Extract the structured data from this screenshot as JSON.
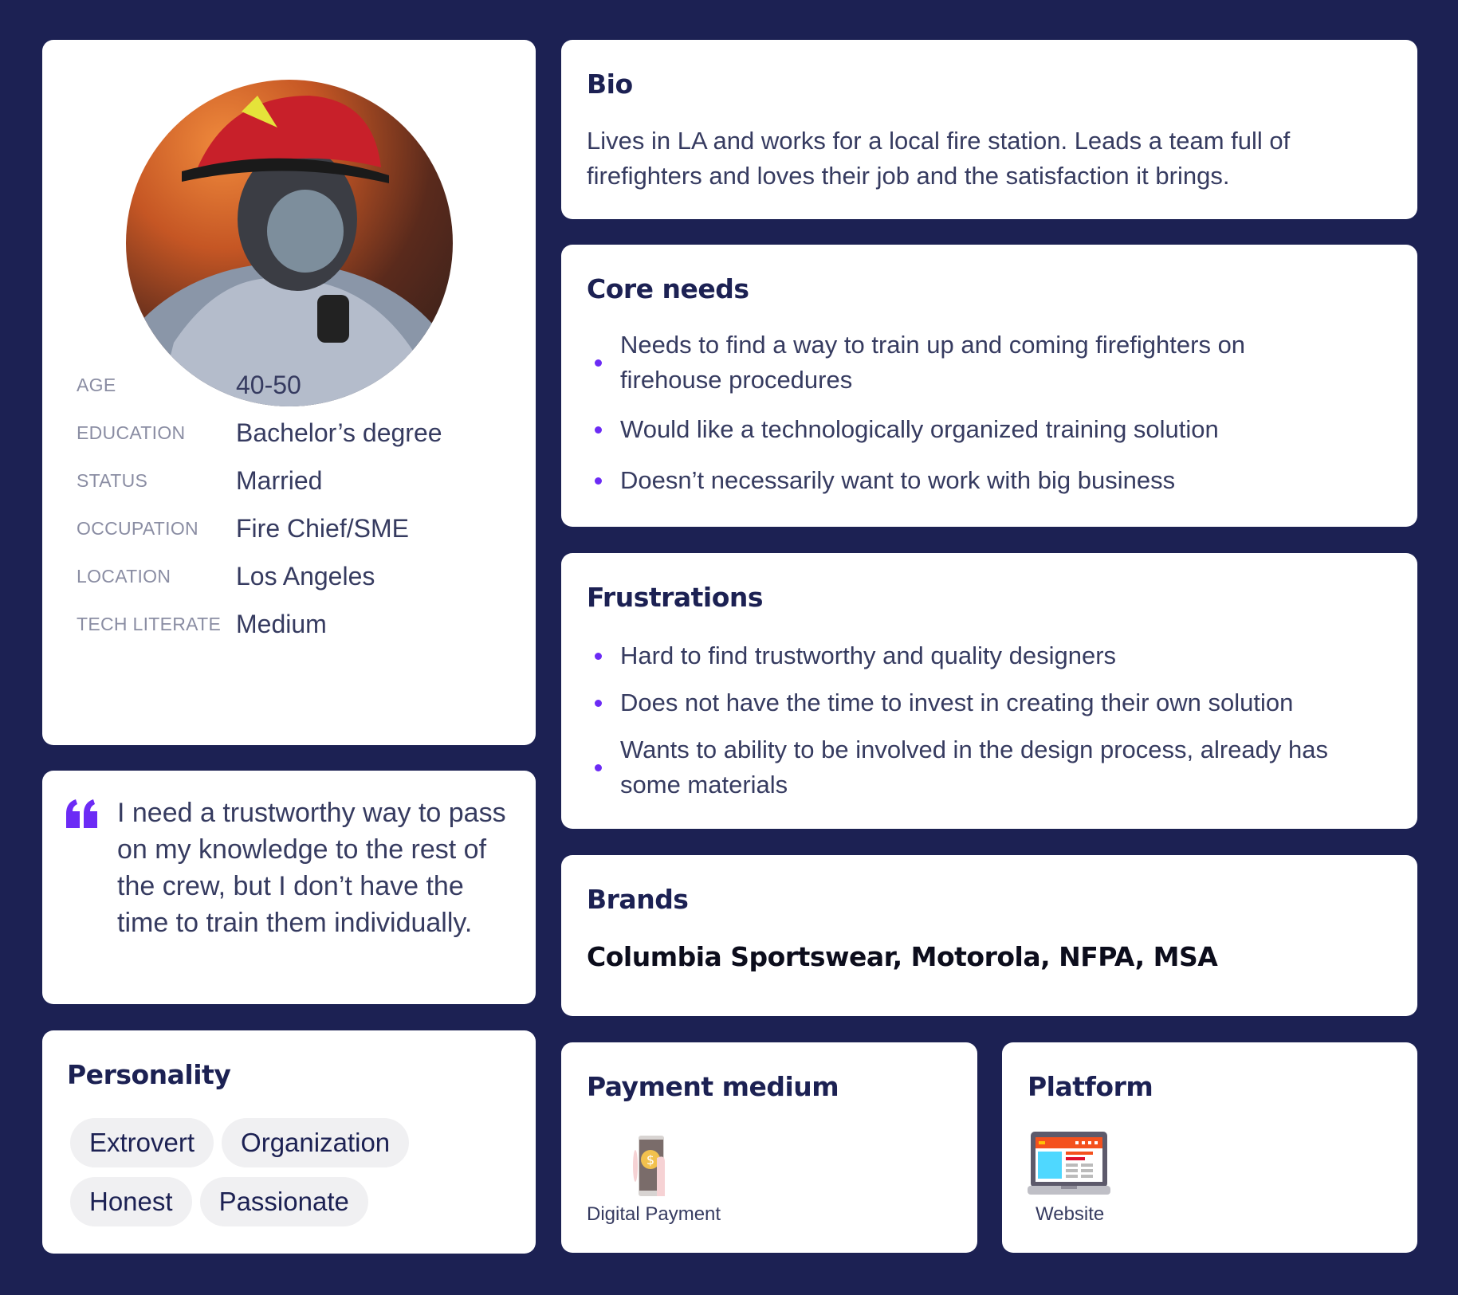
{
  "profile": {
    "fields": [
      {
        "label": "AGE",
        "value": "40-50"
      },
      {
        "label": "EDUCATION",
        "value": "Bachelor’s degree"
      },
      {
        "label": "STATUS",
        "value": "Married"
      },
      {
        "label": "OCCUPATION",
        "value": "Fire Chief/SME"
      },
      {
        "label": "LOCATION",
        "value": "Los Angeles"
      },
      {
        "label": "TECH LITERATE",
        "value": "Medium"
      }
    ]
  },
  "quote": {
    "text": "I need a trustworthy way to pass on my knowledge to the rest of the crew, but I don’t have the time to train them individually.",
    "accent": "#6c2bf5"
  },
  "personality": {
    "title": "Personality",
    "traits": [
      "Extrovert",
      "Organization",
      "Honest",
      "Passionate"
    ]
  },
  "bio": {
    "title": "Bio",
    "text": "Lives in LA and works for a local fire station. Leads a team full of firefighters and loves their job and the satisfaction it brings."
  },
  "core_needs": {
    "title": "Core needs",
    "items": [
      "Needs to find a way to train up and coming firefighters on firehouse procedures",
      "Would like a technologically organized training solution",
      "Doesn’t necessarily want to work with big business"
    ]
  },
  "frustrations": {
    "title": "Frustrations",
    "items": [
      "Hard to find trustworthy and quality designers",
      "Does not have the time to invest in creating their own solution",
      "Wants to ability to be involved in the design process, already has some materials"
    ]
  },
  "brands": {
    "title": "Brands",
    "text": "Columbia Sportswear, Motorola, NFPA, MSA"
  },
  "payment": {
    "title": "Payment medium",
    "label": "Digital Payment",
    "icon": "phone-coin-icon"
  },
  "platform": {
    "title": "Platform",
    "label": "Website",
    "icon": "laptop-website-icon"
  }
}
